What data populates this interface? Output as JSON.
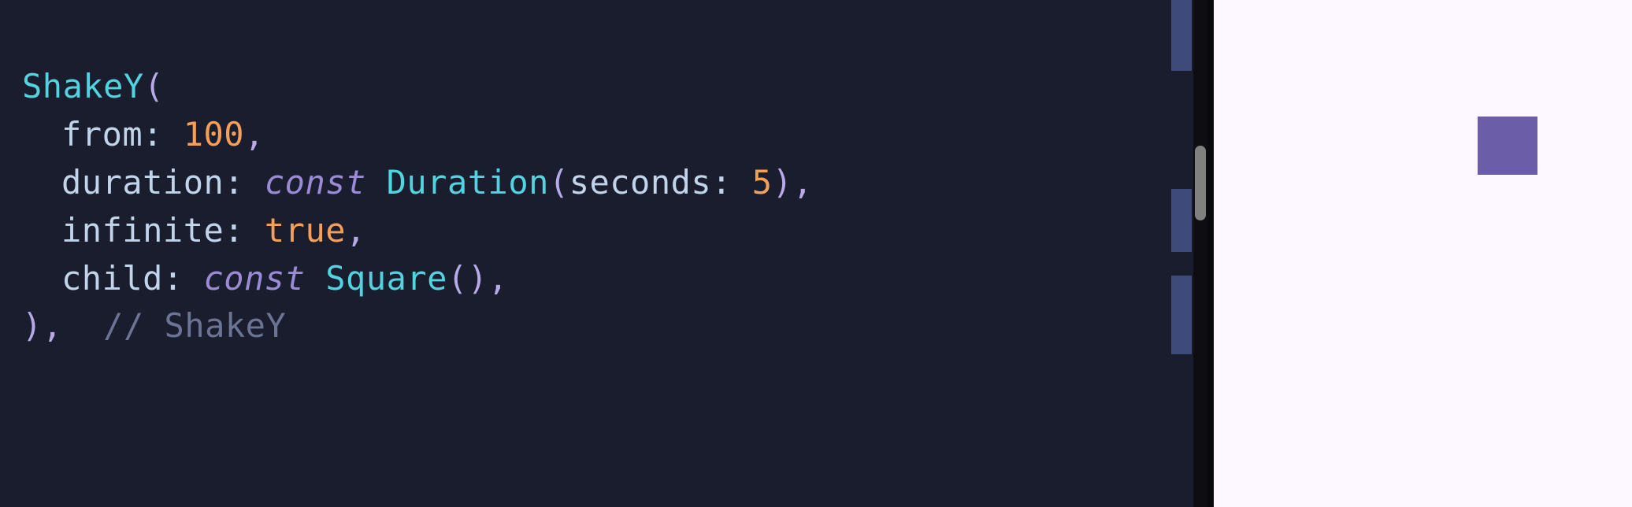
{
  "code": {
    "l1_class": "ShakeY",
    "l1_open": "(",
    "l2_param": "from: ",
    "l2_value": "100",
    "l2_comma": ",",
    "l3_param": "duration: ",
    "l3_keyword": "const",
    "l3_space": " ",
    "l3_class": "Duration",
    "l3_open": "(",
    "l3_inner_param": "seconds: ",
    "l3_inner_value": "5",
    "l3_close": ")",
    "l3_comma": ",",
    "l4_param": "infinite: ",
    "l4_value": "true",
    "l4_comma": ",",
    "l5_param": "child: ",
    "l5_keyword": "const",
    "l5_space": " ",
    "l5_class": "Square",
    "l5_parens": "()",
    "l5_comma": ",",
    "l6_close": ")",
    "l6_comma": ",",
    "l6_spaces": "  ",
    "l6_comment": "// ShakeY"
  },
  "preview": {
    "square_color": "#6b5da8"
  }
}
